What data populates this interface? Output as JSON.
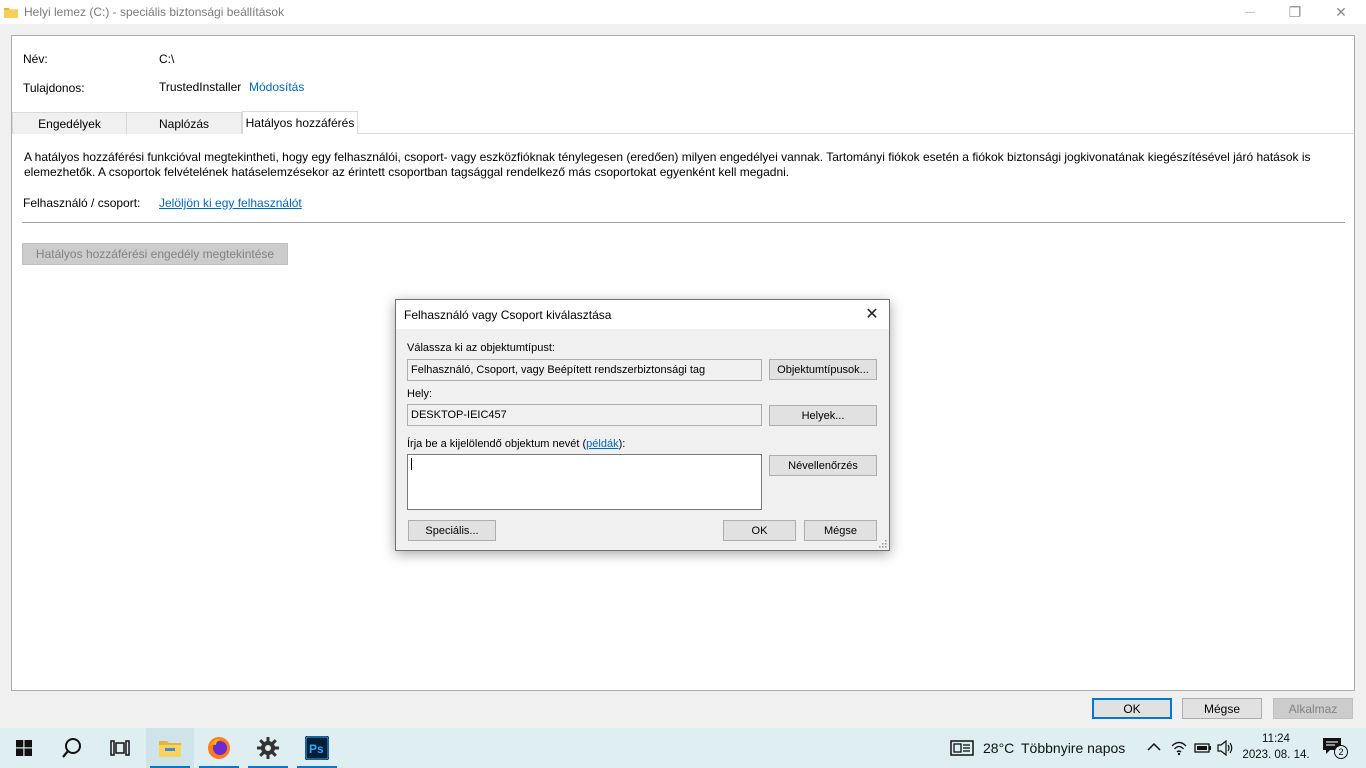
{
  "window": {
    "title": "Helyi lemez (C:) - speciális biztonsági beállítások",
    "controls": {
      "minimize": "—",
      "restore": "❐",
      "close": "✕"
    }
  },
  "info": {
    "name_label": "Név:",
    "name_value": "C:\\",
    "owner_label": "Tulajdonos:",
    "owner_value": "TrustedInstaller",
    "owner_change": "Módosítás"
  },
  "tabs": [
    {
      "label": "Engedélyek"
    },
    {
      "label": "Naplózás"
    },
    {
      "label": "Hatályos hozzáférés"
    }
  ],
  "effective": {
    "description": "A hatályos hozzáférési funkcióval megtekintheti, hogy egy felhasználói, csoport- vagy eszközfióknak ténylegesen (eredően) milyen engedélyei vannak. Tartományi fiókok esetén a fiókok biztonsági jogkivonatának kiegészítésével járó hatások is elemezhetők. A csoportok felvételének hatáselemzésekor az érintett csoportban tagsággal rendelkező más csoportokat egyenként kell megadni.",
    "user_label": "Felhasználó / csoport:",
    "user_link": "Jelöljön ki egy felhasználót",
    "view_button": "Hatályos hozzáférési engedély megtekintése"
  },
  "buttons": {
    "ok": "OK",
    "cancel": "Mégse",
    "apply": "Alkalmaz"
  },
  "dialog": {
    "title": "Felhasználó vagy Csoport kiválasztása",
    "type_label": "Válassza ki az objektumtípust:",
    "type_value": "Felhasználó, Csoport, vagy Beépített rendszerbiztonsági tag",
    "type_button": "Objektumtípusok...",
    "location_label": "Hely:",
    "location_value": "DESKTOP-IEIC457",
    "location_button": "Helyek...",
    "name_label_pre": "Írja be a kijelölendő objektum nevét (",
    "name_label_link": "példák",
    "name_label_post": "):",
    "name_value": "",
    "check_button": "Névellenőrzés",
    "advanced_button": "Speciális...",
    "ok": "OK",
    "cancel": "Mégse"
  },
  "taskbar": {
    "weather_temp": "28°C",
    "weather_text": "Többnyire napos",
    "time": "11:24",
    "date": "2023. 08. 14.",
    "notification_count": "2",
    "accent": "#0078d7"
  }
}
